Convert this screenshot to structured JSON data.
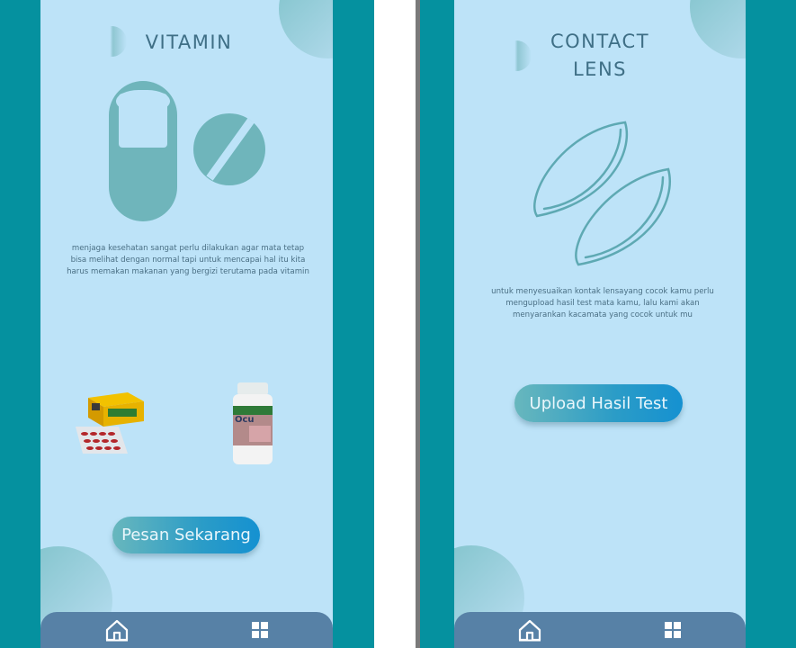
{
  "screens": [
    {
      "title": "VITAMIN",
      "description": "menjaga kesehatan sangat perlu dilakukan agar mata tetap bisa melihat dengan normal tapi untuk mencapai hal itu kita harus memakan makanan yang bergizi terutama pada vitamin",
      "button_label": "Pesan Sekarang"
    },
    {
      "title_line1": "CONTACT",
      "title_line2": "LENS",
      "description": "untuk menyesuaikan kontak lensayang cocok kamu perlu mengupload hasil test mata kamu, lalu kami akan menyarankan kacamata yang cocok untuk mu",
      "button_label": "Upload Hasil Test"
    }
  ],
  "product_label": "Ocu",
  "nav": {
    "home_icon": "home-icon",
    "menu_icon": "grid-icon"
  },
  "colors": {
    "frame": "#05919f",
    "screen": "#bde3f8",
    "navbar": "#5781a6",
    "accent": "#6fb5bb",
    "button": "#1591d1"
  }
}
